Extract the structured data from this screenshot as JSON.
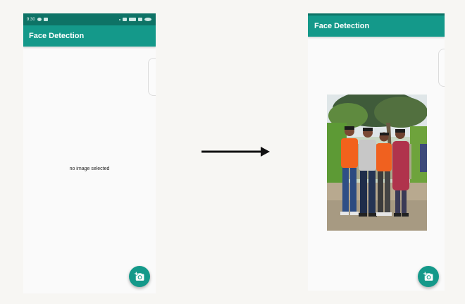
{
  "left_screen": {
    "status_bar": {
      "time": "9:30"
    },
    "app_bar": {
      "title": "Face Detection"
    },
    "body": {
      "empty_message": "no image selected"
    },
    "fab": {
      "icon": "add-a-photo-icon"
    }
  },
  "right_screen": {
    "app_bar": {
      "title": "Face Detection"
    },
    "image": {
      "content": "group-photo"
    },
    "fab": {
      "icon": "add-a-photo-icon"
    }
  },
  "colors": {
    "primary": "#14998a",
    "primary_dark": "#0e7366",
    "background": "#f7f6f3",
    "screen": "#fafafa"
  }
}
